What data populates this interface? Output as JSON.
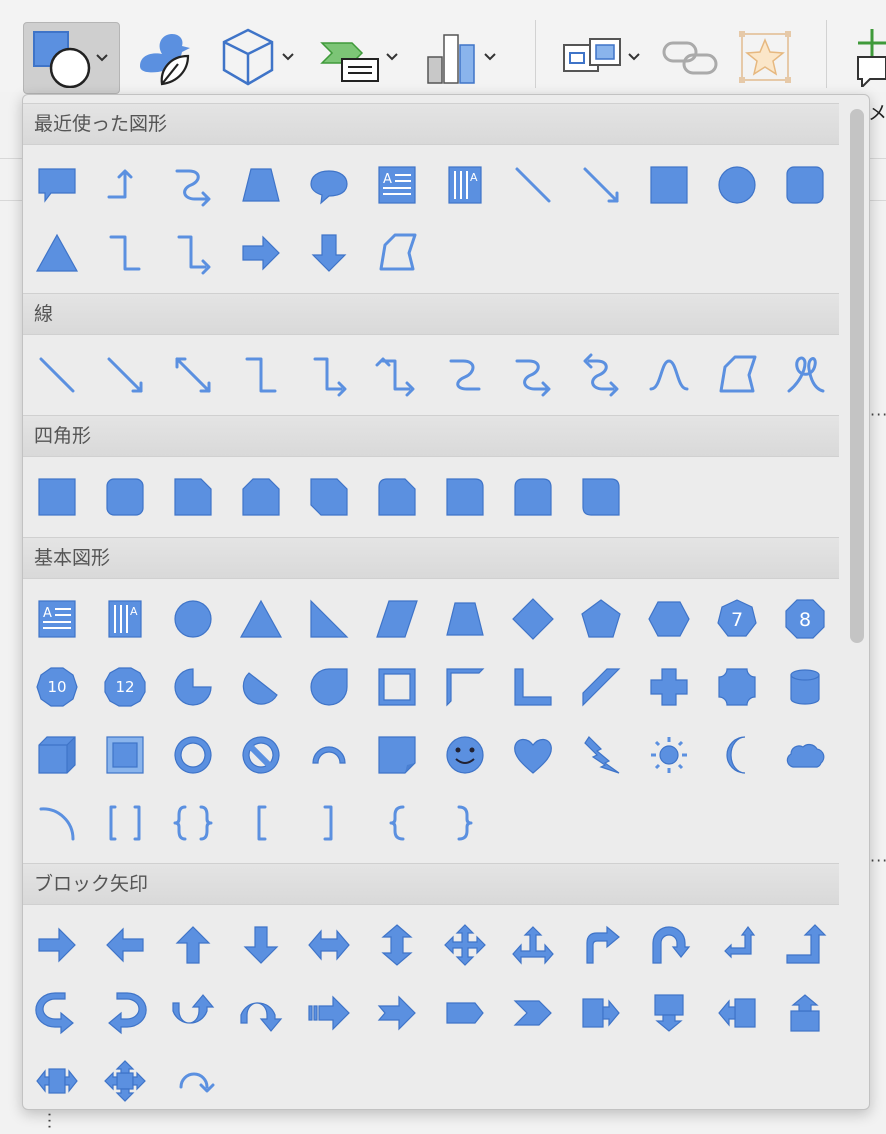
{
  "ribbon": {
    "cut_text": "メ",
    "buttons": [
      {
        "name": "shapes-button",
        "icon": "shapes-icon",
        "active": true
      },
      {
        "name": "icons-button",
        "icon": "icons-duck-icon"
      },
      {
        "name": "3d-models-button",
        "icon": "cube-icon"
      },
      {
        "name": "smartart-button",
        "icon": "smartart-icon"
      },
      {
        "name": "chart-button",
        "icon": "bar-chart-icon"
      },
      {
        "name": "screenshot-button",
        "icon": "screenshot-icon"
      },
      {
        "name": "link-button",
        "icon": "link-icon"
      },
      {
        "name": "action-button",
        "icon": "star-action-icon"
      },
      {
        "name": "comment-button",
        "icon": "comment-icon"
      }
    ]
  },
  "colors": {
    "shape_fill": "#5b90e0",
    "shape_stroke": "#3f74c8",
    "panel_bg": "#ececec",
    "header_bg": "#dcdcdc"
  },
  "sections": [
    {
      "title": "最近使った図形",
      "shapes": [
        "callout-rect",
        "elbow-arrow-up",
        "curved-connector-arrow",
        "trapezoid",
        "speech-bubble-oval",
        "text-box-horizontal",
        "text-box-vertical",
        "line",
        "line-arrow",
        "rectangle",
        "oval",
        "rounded-rectangle",
        "triangle",
        "elbow-connector",
        "elbow-connector-arrow",
        "right-arrow",
        "down-arrow",
        "freeform"
      ]
    },
    {
      "title": "線",
      "shapes": [
        "line",
        "line-arrow",
        "line-double-arrow",
        "elbow-connector",
        "elbow-connector-arrow",
        "elbow-connector-double-arrow",
        "curved-connector",
        "curved-connector-arrow",
        "curved-connector-double-arrow",
        "curve",
        "freeform",
        "scribble"
      ]
    },
    {
      "title": "四角形",
      "shapes": [
        "rectangle",
        "rounded-rectangle",
        "snip-single-corner",
        "snip-same-side",
        "snip-diagonal",
        "snip-round-corner",
        "round-single-corner",
        "round-same-side",
        "round-diagonal"
      ]
    },
    {
      "title": "基本図形",
      "shapes": [
        "text-box-horizontal",
        "text-box-vertical",
        "oval",
        "triangle",
        "right-triangle",
        "parallelogram",
        "trapezoid",
        "diamond",
        "pentagon",
        "hexagon",
        "heptagon",
        "octagon",
        "decagon",
        "dodecagon",
        "pie",
        "chord",
        "teardrop",
        "frame",
        "half-frame",
        "l-shape",
        "diagonal-stripe",
        "cross",
        "plaque",
        "can",
        "cube",
        "bevel",
        "donut",
        "no-symbol",
        "block-arc",
        "folded-corner",
        "smiley",
        "heart",
        "lightning",
        "sun",
        "moon",
        "cloud",
        "arc",
        "double-bracket",
        "double-brace",
        "left-bracket",
        "right-bracket",
        "left-brace",
        "right-brace"
      ],
      "labels": {
        "heptagon": "7",
        "octagon": "8",
        "decagon": "10",
        "dodecagon": "12"
      }
    },
    {
      "title": "ブロック矢印",
      "shapes": [
        "block-right",
        "block-left",
        "block-up",
        "block-down",
        "block-left-right",
        "block-up-down",
        "block-quad",
        "block-left-right-up",
        "block-bent",
        "block-u-turn",
        "block-left-up",
        "block-bent-up",
        "block-curved-right",
        "block-curved-left",
        "block-curved-up",
        "block-curved-down",
        "block-striped-right",
        "block-notched-right",
        "block-pentagon",
        "block-chevron",
        "block-right-callout",
        "block-down-callout",
        "block-left-callout",
        "block-up-callout",
        "block-left-right-callout",
        "block-quad-callout",
        "block-circular"
      ]
    }
  ]
}
